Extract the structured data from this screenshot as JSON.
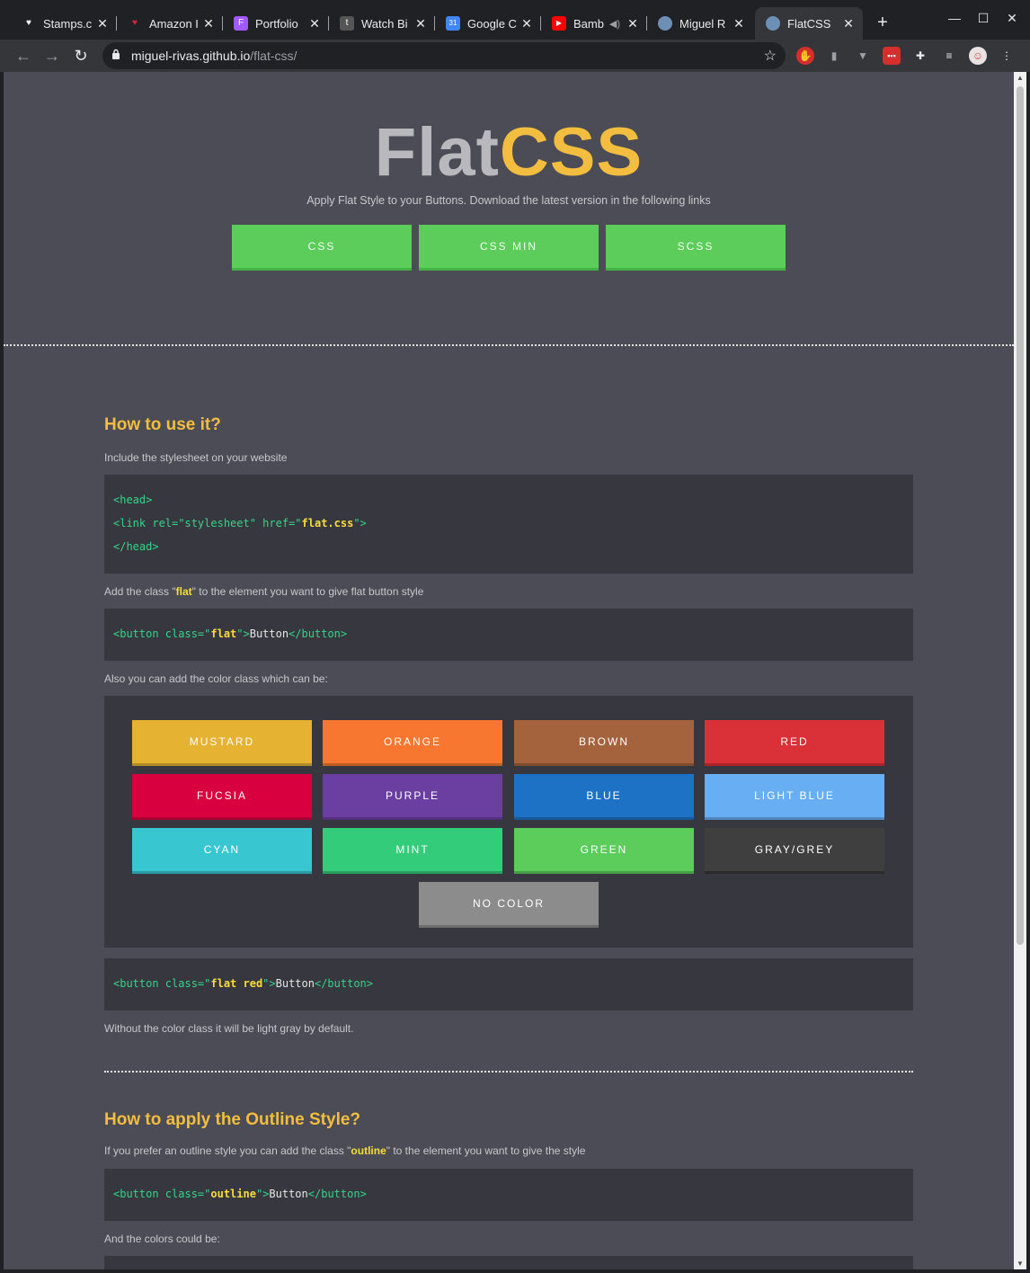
{
  "browser": {
    "tabs": [
      {
        "title": "Stamps.c",
        "fav_color": "#ffffff",
        "fav_glyph": "♥"
      },
      {
        "title": "Amazon I",
        "fav_color": "#d6263a",
        "fav_glyph": "♥"
      },
      {
        "title": "Portfolio",
        "fav_color": "#a259ff",
        "fav_glyph": "F"
      },
      {
        "title": "Watch Bi",
        "fav_color": "#555555",
        "fav_glyph": "t"
      },
      {
        "title": "Google C",
        "fav_color": "#4285f4",
        "fav_glyph": "31"
      },
      {
        "title": "Bamb",
        "fav_color": "#ff0000",
        "fav_glyph": "▶"
      },
      {
        "title": "Miguel R",
        "fav_color": "#6d8fb3",
        "fav_glyph": "●"
      },
      {
        "title": "FlatCSS",
        "fav_color": "#6d8fb3",
        "fav_glyph": "●"
      }
    ],
    "url_host": "miguel-rivas.github.io",
    "url_path": "/flat-css/"
  },
  "hero": {
    "title_flat": "Flat",
    "title_css": "CSS",
    "subtitle": "Apply Flat Style to your Buttons. Download the latest version in the following links",
    "downloads": [
      "CSS",
      "CSS MIN",
      "SCSS"
    ]
  },
  "usage": {
    "heading": "How to use it?",
    "intro": "Include the stylesheet on your website",
    "code1": {
      "line1": "<head>",
      "line2_pre": "<link rel=\"stylesheet\" href=\"",
      "line2_val": "flat.css",
      "line2_post": "\">",
      "line3": "</head>"
    },
    "add_class_pre": "Add the class \"",
    "add_class_val": "flat",
    "add_class_post": "\" to the element you want to give flat button style",
    "code2": {
      "pre": "<button class=\"",
      "val": "flat",
      "mid": "\">",
      "text": "Button",
      "post": "</button>"
    },
    "colors_intro": "Also you can add the color class which can be:",
    "colors": [
      {
        "label": "MUSTARD",
        "color": "#e5b232"
      },
      {
        "label": "ORANGE",
        "color": "#f77731"
      },
      {
        "label": "BROWN",
        "color": "#a4633d"
      },
      {
        "label": "RED",
        "color": "#da3037"
      },
      {
        "label": "FUCSIA",
        "color": "#d9003f"
      },
      {
        "label": "PURPLE",
        "color": "#6b3fa1"
      },
      {
        "label": "BLUE",
        "color": "#1e72c6"
      },
      {
        "label": "LIGHT BLUE",
        "color": "#67aef2"
      },
      {
        "label": "CYAN",
        "color": "#38c7d1"
      },
      {
        "label": "MINT",
        "color": "#32cc7a"
      },
      {
        "label": "GREEN",
        "color": "#5ccc5b"
      },
      {
        "label": "GRAY/GREY",
        "color": "#3f3f3f"
      },
      {
        "label": "NO COLOR",
        "color": "#8c8c8c"
      }
    ],
    "code3": {
      "pre": "<button class=\"",
      "val": "flat red",
      "mid": "\">",
      "text": "Button",
      "post": "</button>"
    },
    "default_note": "Without the color class it will be light gray by default."
  },
  "outline": {
    "heading": "How to apply the Outline Style?",
    "intro_pre": "If you prefer an outline style you can add the class \"",
    "intro_val": "outline",
    "intro_post": "\" to the element you want to give the style",
    "code": {
      "pre": "<button class=\"",
      "val": "outline",
      "mid": "\">",
      "text": "Button",
      "post": "</button>"
    },
    "colors_intro": "And the colors could be:"
  }
}
